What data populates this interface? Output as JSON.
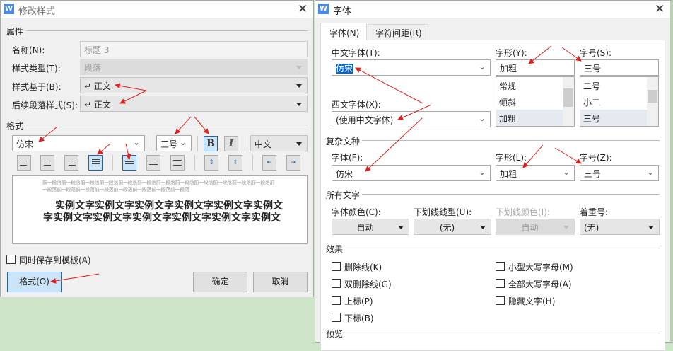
{
  "modify_style": {
    "title": "修改样式",
    "properties_section": "属性",
    "name_label": "名称(N):",
    "name_value": "标题 3",
    "type_label": "样式类型(T):",
    "type_value": "段落",
    "based_on_label": "样式基于(B):",
    "based_on_value": "↵ 正文",
    "next_label": "后续段落样式(S):",
    "next_value": "↵ 正文",
    "format_section": "格式",
    "font_value": "仿宋",
    "size_value": "三号",
    "bold": "B",
    "italic": "I",
    "script_value": "中文",
    "preview_prev": "前一段落前一段落前一段落前一段落前一段落前一段落前一段落前一段落前一段落前一段落前一段落前一段落前一段落前一段落前一段落前一段落前一段落前一段落前一段落前一段落",
    "preview_sample1": "实例文字实例文字实例文字实例文字实例文字实例文",
    "preview_sample2": "字实例文字实例文字实例文字实例文字实例文字实例文",
    "save_template_label": "同时保存到模板(A)",
    "format_button": "格式(O)",
    "ok_button": "确定",
    "cancel_button": "取消"
  },
  "font_dialog": {
    "title": "字体",
    "tabs": [
      "字体(N)",
      "字符间距(R)"
    ],
    "cn_font_label": "中文字体(T):",
    "cn_font_value": "仿宋",
    "style_label": "字形(Y):",
    "style_value": "加粗",
    "style_options": [
      "常规",
      "倾斜",
      "加粗"
    ],
    "size_label": "字号(S):",
    "size_value": "三号",
    "size_options": [
      "二号",
      "小二",
      "三号"
    ],
    "west_font_label": "西文字体(X):",
    "west_font_value": "(使用中文字体)",
    "complex_section": "复杂文种",
    "complex_font_label": "字体(F):",
    "complex_font_value": "仿宋",
    "complex_style_label": "字形(L):",
    "complex_style_value": "加粗",
    "complex_size_label": "字号(Z):",
    "complex_size_value": "三号",
    "all_text_section": "所有文字",
    "color_label": "字体颜色(C):",
    "color_value": "自动",
    "underline_label": "下划线线型(U):",
    "underline_value": "(无)",
    "underline_color_label": "下划线颜色(I):",
    "underline_color_value": "自动",
    "emphasis_label": "着重号:",
    "emphasis_value": "(无)",
    "effects_section": "效果",
    "effects_left": [
      "删除线(K)",
      "双删除线(G)",
      "上标(P)",
      "下标(B)"
    ],
    "effects_right": [
      "小型大写字母(M)",
      "全部大写字母(A)",
      "隐藏文字(H)"
    ],
    "preview_section": "预览"
  },
  "colors": {
    "annotation_arrow": "#e02020",
    "accent": "#4a8ae6"
  }
}
